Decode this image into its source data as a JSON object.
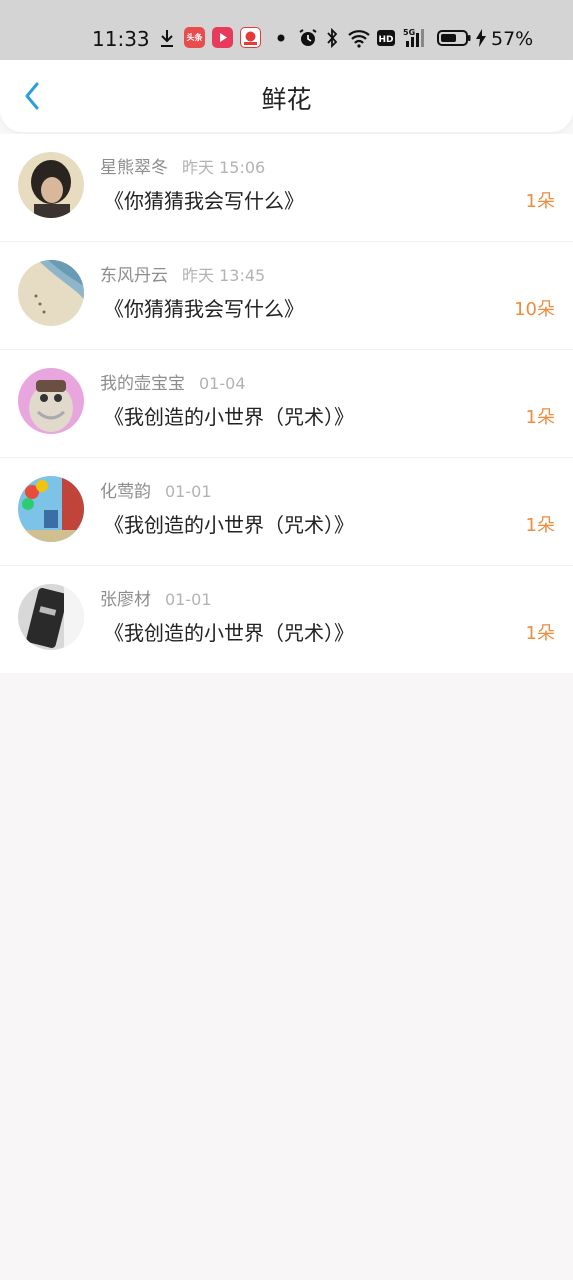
{
  "status_bar": {
    "time": "11:33",
    "battery": "57%",
    "app_icons": [
      {
        "name": "toutiao-app-icon",
        "label": "头条",
        "color": "#e84c4c"
      },
      {
        "name": "video-app-icon",
        "label": "",
        "color": "#e83a5a"
      },
      {
        "name": "news-app-icon",
        "label": "",
        "color": "#e33a3a"
      }
    ]
  },
  "header": {
    "title": "鲜花"
  },
  "list": [
    {
      "name": "星熊翠冬",
      "time": "昨天 15:06",
      "title": "《你猜猜我会写什么》",
      "count": "1朵"
    },
    {
      "name": "东风丹云",
      "time": "昨天 13:45",
      "title": "《你猜猜我会写什么》",
      "count": "10朵"
    },
    {
      "name": "我的壶宝宝",
      "time": "01-04",
      "title": "《我创造的小世界（咒术）》",
      "count": "1朵"
    },
    {
      "name": "化莺韵",
      "time": "01-01",
      "title": "《我创造的小世界（咒术）》",
      "count": "1朵"
    },
    {
      "name": "张廖材",
      "time": "01-01",
      "title": "《我创造的小世界（咒术）》",
      "count": "1朵"
    }
  ],
  "colors": {
    "accent": "#2a9fe0",
    "count": "#ef8c3e"
  }
}
